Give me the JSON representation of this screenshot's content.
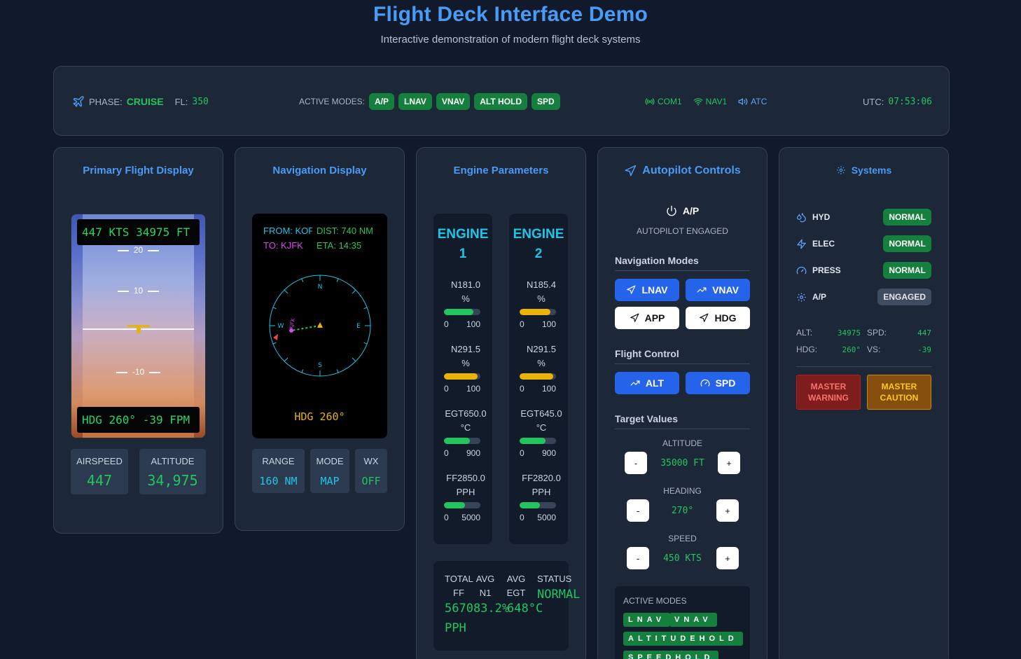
{
  "header": {
    "title": "Flight Deck Interface Demo",
    "subtitle": "Interactive demonstration of modern flight deck systems"
  },
  "status_bar": {
    "phase_label": "PHASE:",
    "phase_value": "CRUISE",
    "fl_label": "FL:",
    "fl_value": "350",
    "modes_label": "ACTIVE MODES:",
    "modes": [
      "A/P",
      "LNAV",
      "VNAV",
      "ALT HOLD",
      "SPD"
    ],
    "comms": [
      "COM1",
      "NAV1",
      "ATC"
    ],
    "utc_label": "UTC:",
    "utc_value": "07:53:06"
  },
  "pfd": {
    "title": "Primary Flight Display",
    "top_readout": "447 KTS  34975 FT",
    "bottom_readout": "HDG 260°  -39 FPM",
    "pitch_labels": [
      "20",
      "10",
      "-10"
    ],
    "airspeed_label": "AIRSPEED",
    "airspeed_value": "447",
    "altitude_label": "ALTITUDE",
    "altitude_value": "34,975"
  },
  "nd": {
    "title": "Navigation Display",
    "from": "FROM: KOF",
    "to": "TO: KJFK",
    "dist": "DIST: 740 NM",
    "eta": "ETA: 14:35",
    "compass": [
      "N",
      "E",
      "S",
      "W"
    ],
    "waypoint": "KJFK",
    "hdg": "HDG 260°",
    "range_label": "RANGE",
    "range_value": "160 NM",
    "mode_label": "MODE",
    "mode_value": "MAP",
    "wx_label": "WX",
    "wx_value": "OFF"
  },
  "engines": {
    "title": "Engine Parameters",
    "units": [
      {
        "name_line1": "ENGINE",
        "name_line2": "1",
        "params": [
          {
            "line1": "N181.0",
            "line2": "%",
            "min": "0",
            "max": "100",
            "level": 0.81,
            "color": "#22c55e"
          },
          {
            "line1": "N291.5",
            "line2": "%",
            "min": "0",
            "max": "100",
            "level": 0.915,
            "color": "#eab308"
          },
          {
            "line1": "EGT650.0",
            "line2": "°C",
            "min": "0",
            "max": "900",
            "level": 0.72,
            "color": "#22c55e"
          },
          {
            "line1": "FF2850.0",
            "line2": "PPH",
            "min": "0",
            "max": "5000",
            "level": 0.57,
            "color": "#22c55e"
          }
        ]
      },
      {
        "name_line1": "ENGINE",
        "name_line2": "2",
        "params": [
          {
            "line1": "N185.4",
            "line2": "%",
            "min": "0",
            "max": "100",
            "level": 0.854,
            "color": "#eab308"
          },
          {
            "line1": "N291.5",
            "line2": "%",
            "min": "0",
            "max": "100",
            "level": 0.915,
            "color": "#eab308"
          },
          {
            "line1": "EGT645.0",
            "line2": "°C",
            "min": "0",
            "max": "900",
            "level": 0.717,
            "color": "#22c55e"
          },
          {
            "line1": "FF2820.0",
            "line2": "PPH",
            "min": "0",
            "max": "5000",
            "level": 0.564,
            "color": "#22c55e"
          }
        ]
      }
    ],
    "summary": {
      "total_ff_label": "TOTAL FF",
      "total_ff_value": "567083.2%",
      "total_ff_unit": "PPH",
      "avg_n1_label": "AVG N1",
      "avg_egt_label": "AVG EGT",
      "avg_egt_value": "648°C",
      "status_label": "STATUS",
      "status_value": "NORMAL"
    }
  },
  "autopilot": {
    "title": "Autopilot Controls",
    "ap_label": "A/P",
    "ap_status": "AUTOPILOT ENGAGED",
    "nav_modes_heading": "Navigation Modes",
    "nav_buttons": [
      "LNAV",
      "VNAV",
      "APP",
      "HDG"
    ],
    "flight_control_heading": "Flight Control",
    "fc_buttons": [
      "ALT",
      "SPD"
    ],
    "targets_heading": "Target Values",
    "targets": [
      {
        "label": "ALTITUDE",
        "value": "35000 FT"
      },
      {
        "label": "HEADING",
        "value": "270°"
      },
      {
        "label": "SPEED",
        "value": "450 KTS"
      }
    ],
    "minus": "-",
    "plus": "+",
    "active_modes_label": "ACTIVE MODES",
    "active_modes": [
      "LNAV",
      "VNAV",
      "ALTITUDEHOLD",
      "SPEEDHOLD"
    ]
  },
  "systems": {
    "title": "Systems",
    "rows": [
      {
        "name": "HYD",
        "status": "NORMAL"
      },
      {
        "name": "ELEC",
        "status": "NORMAL"
      },
      {
        "name": "PRESS",
        "status": "NORMAL"
      },
      {
        "name": "A/P",
        "status": "ENGAGED"
      }
    ],
    "alt_label": "ALT:",
    "alt_value": "34975",
    "spd_label": "SPD:",
    "spd_value": "447",
    "hdg_label": "HDG:",
    "hdg_value": "260°",
    "vs_label": "VS:",
    "vs_value": "-39",
    "master_warning": "MASTER WARNING",
    "master_caution": "MASTER CAUTION"
  },
  "colors": {
    "accent": "#4a9bf5",
    "ok": "#22c55e",
    "warning_bg": "#7f1d1d",
    "caution_bg": "#854d0e"
  }
}
